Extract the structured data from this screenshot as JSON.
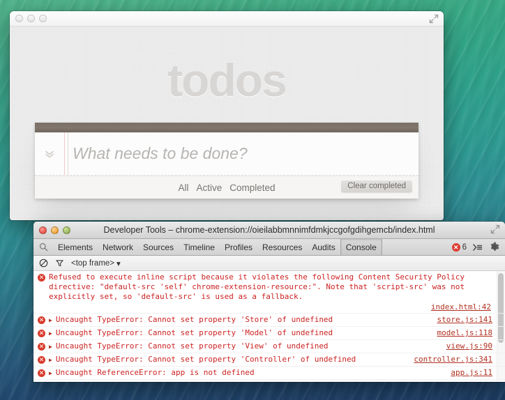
{
  "todo_window": {
    "title": "",
    "lights": [
      "close",
      "minimize",
      "zoom"
    ],
    "fullscreen_icon": "fullscreen-icon",
    "heading": "todos",
    "toggle_all_icon": "chevron-double-down-icon",
    "new_todo_placeholder": "What needs to be done?",
    "new_todo_value": "",
    "filters": [
      "All",
      "Active",
      "Completed"
    ],
    "clear_completed_label": "Clear completed"
  },
  "devtools_window": {
    "title": "Developer Tools – chrome-extension://oieilabbmnnimfdmkjccgofgdihgemcb/index.html",
    "lights": [
      "close",
      "minimize",
      "zoom"
    ],
    "fullscreen_icon": "fullscreen-icon",
    "search_icon": "search-icon",
    "tabs": [
      {
        "label": "Elements",
        "active": false
      },
      {
        "label": "Network",
        "active": false
      },
      {
        "label": "Sources",
        "active": false
      },
      {
        "label": "Timeline",
        "active": false
      },
      {
        "label": "Profiles",
        "active": false
      },
      {
        "label": "Resources",
        "active": false
      },
      {
        "label": "Audits",
        "active": false
      },
      {
        "label": "Console",
        "active": true
      }
    ],
    "error_count": "6",
    "dock_icon": "dock-side-icon",
    "settings_icon": "gear-icon",
    "toolbar": {
      "clear_icon": "clear-console-icon",
      "filter_icon": "funnel-filter-icon",
      "frame_label": "<top frame>",
      "frame_caret": "▾"
    },
    "messages": [
      {
        "level": "error",
        "icon": "error-icon",
        "expandable": false,
        "text": "Refused to execute inline script because it violates the following Content Security Policy directive: \"default-src 'self' chrome-extension-resource:\". Note that 'script-src' was not explicitly set, so 'default-src' is used as a fallback.",
        "source": "index.html:42",
        "multiline": true
      },
      {
        "level": "error",
        "icon": "error-icon",
        "expandable": true,
        "text": "Uncaught TypeError: Cannot set property 'Store' of undefined",
        "source": "store.js:141",
        "multiline": false
      },
      {
        "level": "error",
        "icon": "error-icon",
        "expandable": true,
        "text": "Uncaught TypeError: Cannot set property 'Model' of undefined",
        "source": "model.js:118",
        "multiline": false
      },
      {
        "level": "error",
        "icon": "error-icon",
        "expandable": true,
        "text": "Uncaught TypeError: Cannot set property 'View' of undefined",
        "source": "view.js:90",
        "multiline": false
      },
      {
        "level": "error",
        "icon": "error-icon",
        "expandable": true,
        "text": "Uncaught TypeError: Cannot set property 'Controller' of undefined",
        "source": "controller.js:341",
        "multiline": false
      },
      {
        "level": "error",
        "icon": "error-icon",
        "expandable": true,
        "text": "Uncaught ReferenceError: app is not defined",
        "source": "app.js:11",
        "multiline": false
      }
    ],
    "prompt": {
      "caret": "›",
      "value": ""
    }
  },
  "colors": {
    "error_red": "#cc2222",
    "error_badge": "#dd3b30",
    "prompt_blue": "#4a7fc1",
    "todo_heading": "#d8d6d4",
    "todo_strip": "#7a6f66"
  }
}
